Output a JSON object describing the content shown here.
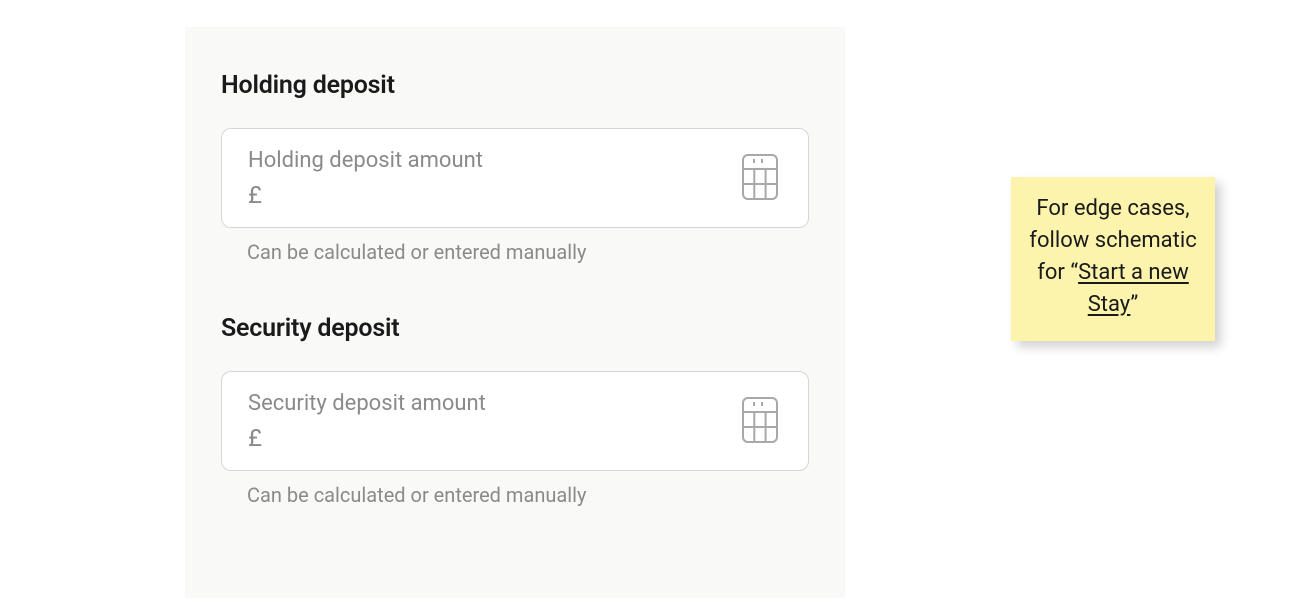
{
  "form": {
    "holding": {
      "heading": "Holding deposit",
      "label": "Holding deposit amount",
      "currency": "£",
      "helper": "Can be calculated or entered manually"
    },
    "security": {
      "heading": "Security deposit",
      "label": "Security deposit amount",
      "currency": "£",
      "helper": "Can be calculated or entered manually"
    }
  },
  "note": {
    "line1": "For edge cases, follow schematic for “",
    "link": "Start a new Stay",
    "line2": "”"
  }
}
